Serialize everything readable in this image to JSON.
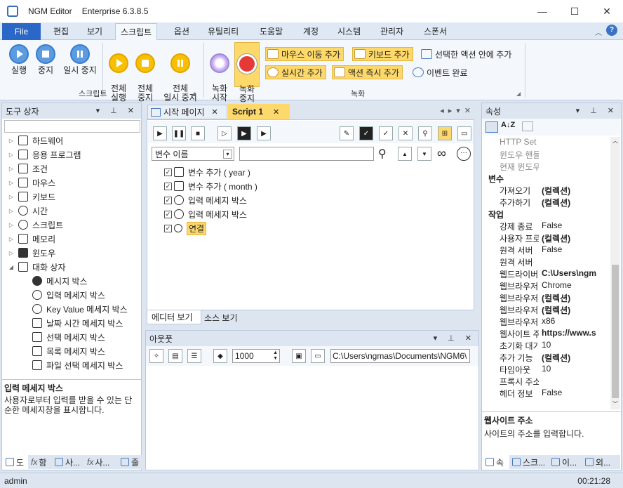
{
  "window": {
    "title": "NGM Editor",
    "edition": "Enterprise 6.3.8.5",
    "minimize": "—",
    "maximize": "☐",
    "close": "✕"
  },
  "menu": {
    "file": "File",
    "tabs": [
      "편집",
      "보기",
      "스크립트",
      "옵션",
      "유틸리티",
      "도움말",
      "계정",
      "시스템",
      "관리자",
      "스폰서"
    ],
    "active_index": 2,
    "help": "?"
  },
  "ribbon": {
    "script_group": {
      "label": "스크립트",
      "run": "실행",
      "stop": "중지",
      "pause": "일시 중지",
      "run_all": "전체\n실행",
      "stop_all": "전체\n중지",
      "pause_all": "전체\n일시 중지"
    },
    "record_group": {
      "label": "녹화",
      "start": "녹화\n시작",
      "stop": "녹화\n중지",
      "add_mouse": "마우스 이동 추가",
      "add_keyboard": "키보드 추가",
      "in_selected": "선택한 액션 안에 추가",
      "add_realtime": "실시간 추가",
      "add_action_now": "액션 즉시 추가",
      "event_done": "이벤트 완료"
    }
  },
  "toolbox": {
    "title": "도구 상자",
    "items": [
      "하드웨어",
      "응용 프로그램",
      "조건",
      "마우스",
      "키보드",
      "시간",
      "스크립트",
      "메모리",
      "윈도우",
      "대화 상자"
    ],
    "children": [
      "메시지 박스",
      "입력 메세지 박스",
      "Key Value 메세지 박스",
      "날짜 시간 메세지 박스",
      "선택 메세지 박스",
      "목록 메세지 박스",
      "파일 선택 메세지 박스"
    ],
    "desc_title": "입력 메세지 박스",
    "desc_text": "사용자로부터 입력를 받을 수 있는 단순한 메세지창을 표시합니다.",
    "bottom_tabs": [
      "도",
      "함",
      "사...",
      "사...",
      "줄"
    ]
  },
  "editor": {
    "tabs": {
      "start_page": "시작 페이지",
      "script1": "Script 1"
    },
    "var_select": "변수 이름",
    "search_placeholder": "",
    "rows": [
      "변수 추가 ( year )",
      "변수 추가 ( month )",
      "입력 메세지 박스",
      "입력 메세지 박스",
      "연결"
    ],
    "view_tabs": {
      "editor": "에디터 보기",
      "source": "소스 보기"
    }
  },
  "output": {
    "title": "아웃풋",
    "count": "1000",
    "path": "C:\\Users\\ngmas\\Documents\\NGM6\\"
  },
  "properties": {
    "title": "속성",
    "rows": [
      {
        "k": "HTTP Set",
        "v": "",
        "style": "gray"
      },
      {
        "k": "윈도우 핸들",
        "v": "",
        "style": "gray"
      },
      {
        "k": "현재 윈도우",
        "v": "",
        "style": "gray"
      },
      {
        "k": "변수",
        "v": "",
        "style": "cat"
      },
      {
        "k": "가져오기",
        "v": "(컬렉션)",
        "style": "bold"
      },
      {
        "k": "추가하기",
        "v": "(컬렉션)",
        "style": "bold"
      },
      {
        "k": "작업",
        "v": "",
        "style": "cat"
      },
      {
        "k": "강제 종료",
        "v": "False",
        "style": ""
      },
      {
        "k": "사용자 프로필",
        "v": "(컬렉션)",
        "style": "bold"
      },
      {
        "k": "원격 서버",
        "v": "False",
        "style": ""
      },
      {
        "k": "원격 서버",
        "v": "",
        "style": ""
      },
      {
        "k": "웹드라이버",
        "v": "C:\\Users\\ngm",
        "style": "bold"
      },
      {
        "k": "웹브라우저",
        "v": "Chrome",
        "style": ""
      },
      {
        "k": "웹브라우저",
        "v": "(컬렉션)",
        "style": "bold"
      },
      {
        "k": "웹브라우저",
        "v": "(컬렉션)",
        "style": "bold"
      },
      {
        "k": "웹브라우저",
        "v": "x86",
        "style": ""
      },
      {
        "k": "웹사이트 주소",
        "v": "https://www.s",
        "style": "bold"
      },
      {
        "k": "초기화 대기",
        "v": "10",
        "style": ""
      },
      {
        "k": "추가 기능",
        "v": "(컬렉션)",
        "style": "bold"
      },
      {
        "k": "타임아웃",
        "v": "10",
        "style": ""
      },
      {
        "k": "프록시 주소",
        "v": "",
        "style": ""
      },
      {
        "k": "헤더 정보",
        "v": "False",
        "style": ""
      }
    ],
    "desc_title": "웹사이트 주소",
    "desc_text": "사이트의 주소를 입력합니다.",
    "bottom_tabs": [
      "속",
      "스크...",
      "이...",
      "외..."
    ]
  },
  "status": {
    "user": "admin",
    "time": "00:21:28"
  },
  "colors": {
    "accent": "#2b67c6",
    "highlight": "#fdd86a",
    "tab_active": "#fdd86a"
  }
}
